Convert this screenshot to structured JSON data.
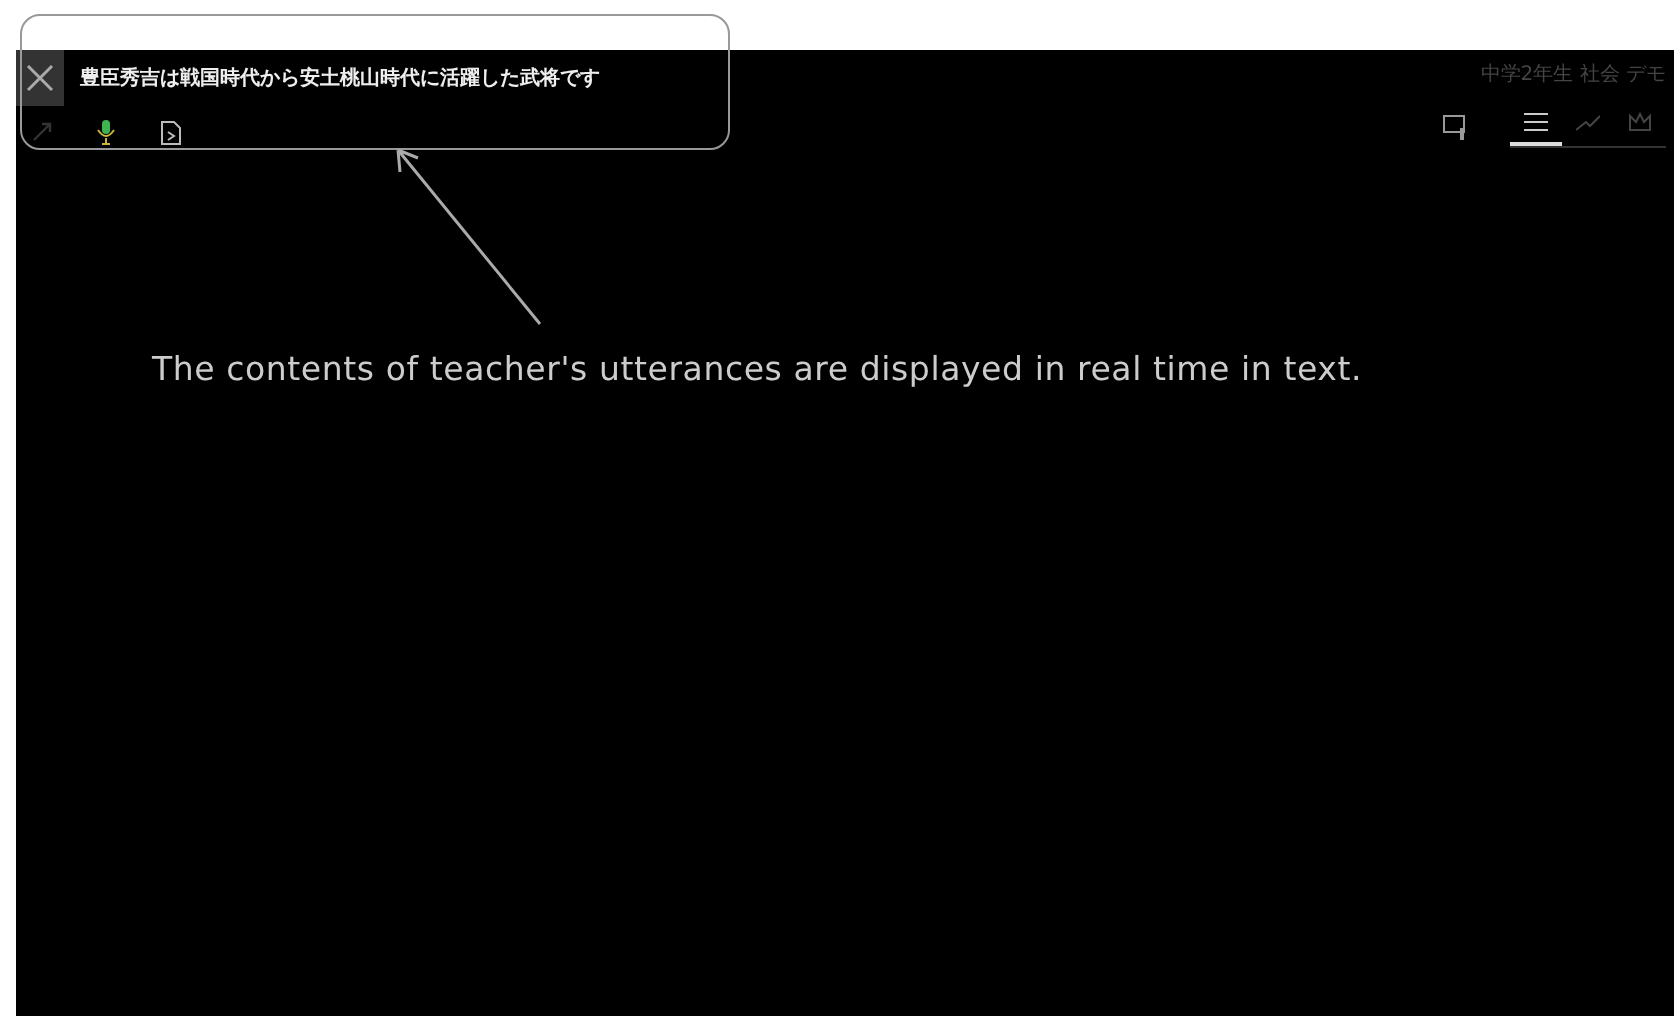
{
  "caption": {
    "text": "豊臣秀吉は戦国時代から安土桃山時代に活躍した武将です",
    "mic_on": true
  },
  "header": {
    "title": "中学2年生 社会 デモ"
  },
  "tabs": [
    {
      "kind": "list",
      "selected": true
    },
    {
      "kind": "chart",
      "selected": false
    },
    {
      "kind": "crown",
      "selected": false
    }
  ],
  "annotation": {
    "text": "The contents of teacher's utterances are displayed in real time in text."
  }
}
